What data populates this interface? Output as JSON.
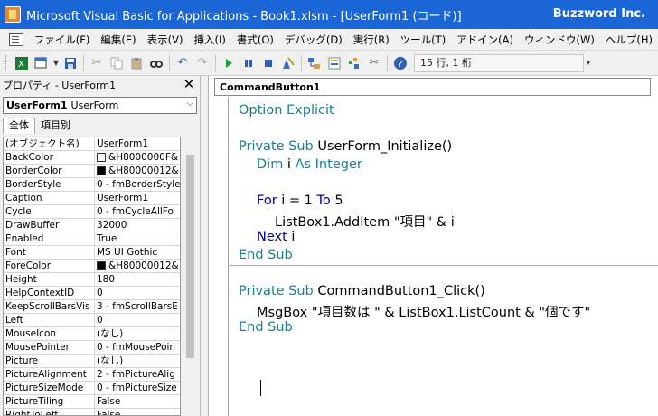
{
  "window": {
    "title": "Microsoft Visual Basic for Applications - Book1.xlsm - [UserForm1 (コード)]",
    "brand": "Buzzword Inc."
  },
  "menu": [
    "ファイル(F)",
    "編集(E)",
    "表示(V)",
    "挿入(I)",
    "書式(O)",
    "デバッグ(D)",
    "実行(R)",
    "ツール(T)",
    "アドイン(A)",
    "ウィンドウ(W)",
    "ヘルプ(H)"
  ],
  "toolbar": {
    "cursor_position": "15 行, 1 桁",
    "icons": [
      "excel-icon",
      "insert-form-icon",
      "save-icon",
      "cut-icon",
      "copy-icon",
      "paste-icon",
      "find-icon",
      "undo-icon",
      "redo-icon",
      "run-icon",
      "break-icon",
      "reset-icon",
      "design-mode-icon",
      "project-explorer-icon",
      "properties-icon",
      "object-browser-icon",
      "toolbox-icon",
      "help-icon"
    ]
  },
  "properties": {
    "title": "プロパティ - UserForm1",
    "object_name": "UserForm1",
    "object_type": "UserForm",
    "tabs": [
      "全体",
      "項目別"
    ],
    "rows": [
      {
        "name": "(オブジェクト名)",
        "value": "UserForm1"
      },
      {
        "name": "BackColor",
        "value": "&H8000000F&",
        "swatch": "#ffffff"
      },
      {
        "name": "BorderColor",
        "value": "&H80000012&",
        "swatch": "#000000"
      },
      {
        "name": "BorderStyle",
        "value": "0 - fmBorderStyle"
      },
      {
        "name": "Caption",
        "value": "UserForm1"
      },
      {
        "name": "Cycle",
        "value": "0 - fmCycleAllFo"
      },
      {
        "name": "DrawBuffer",
        "value": "32000"
      },
      {
        "name": "Enabled",
        "value": "True"
      },
      {
        "name": "Font",
        "value": "MS UI Gothic"
      },
      {
        "name": "ForeColor",
        "value": "&H80000012&",
        "swatch": "#000000"
      },
      {
        "name": "Height",
        "value": "180"
      },
      {
        "name": "HelpContextID",
        "value": "0"
      },
      {
        "name": "KeepScrollBarsVis",
        "value": "3 - fmScrollBarsE"
      },
      {
        "name": "Left",
        "value": "0"
      },
      {
        "name": "MouseIcon",
        "value": "(なし)"
      },
      {
        "name": "MousePointer",
        "value": "0 - fmMousePoin"
      },
      {
        "name": "Picture",
        "value": "(なし)"
      },
      {
        "name": "PictureAlignment",
        "value": "2 - fmPictureAlig"
      },
      {
        "name": "PictureSizeMode",
        "value": "0 - fmPictureSize"
      },
      {
        "name": "PictureTiling",
        "value": "False"
      },
      {
        "name": "RightToLeft",
        "value": "False"
      }
    ]
  },
  "code": {
    "object_box": "CommandButton1",
    "l1_kw": "Option Explicit",
    "l2_kw": "Private Sub",
    "l2_rest": " UserForm_Initialize()",
    "l3_kw1": "Dim",
    "l3_mid": " i ",
    "l3_kw2": "As Integer",
    "l4_kw1": "For",
    "l4_mid": " i = 1 ",
    "l4_kw2": "To",
    "l4_rest": " 5",
    "l5_text": "ListBox1.AddItem \"項目\" & i",
    "l6_kw": "Next",
    "l6_rest": " i",
    "l7_kw": "End Sub",
    "l8_kw": "Private Sub",
    "l8_rest": " CommandButton1_Click()",
    "l9_text": "MsgBox \"項目数は \" & ListBox1.ListCount & \"個です\"",
    "l10_kw": "End Sub"
  }
}
